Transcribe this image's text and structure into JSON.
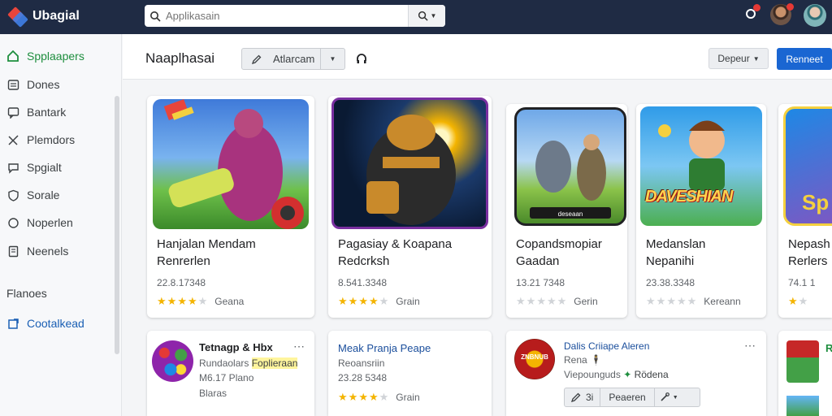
{
  "app": {
    "name": "Ubagial"
  },
  "search": {
    "placeholder": "Applikasain",
    "value": ""
  },
  "header": {
    "title": "Naaplhasai",
    "action_label": "Atlarcam",
    "sort_label": "Depeur",
    "primary_label": "Renneet"
  },
  "sidebar": {
    "items": [
      {
        "label": "Spplaapers",
        "icon": "home-icon"
      },
      {
        "label": "Dones",
        "icon": "list-icon"
      },
      {
        "label": "Bantark",
        "icon": "chat-icon"
      },
      {
        "label": "Plemdors",
        "icon": "tools-icon"
      },
      {
        "label": "Spgialt",
        "icon": "bubble-icon"
      },
      {
        "label": "Sorale",
        "icon": "shield-icon"
      },
      {
        "label": "Noperlen",
        "icon": "circle-icon"
      },
      {
        "label": "Neenels",
        "icon": "doc-icon"
      }
    ],
    "section_label": "Flanoes",
    "link_label": "Cootalkead"
  },
  "featured": [
    {
      "line1": "Hanjalan Mendam",
      "line2": "Renrerlen",
      "meta": "22.8.17348",
      "stars": 4,
      "label": "Geana"
    },
    {
      "line1": "Pagasiay & Koapana",
      "line2": "Redcrksh",
      "meta": "8.541.3348",
      "stars": 4,
      "label": "Grain"
    },
    {
      "line1": "Copandsmopiar",
      "line2": "Gaadan",
      "meta": "13.21 7348",
      "stars": 0,
      "label": "Gerin"
    },
    {
      "line1": "Medanslan",
      "line2": "Nepanihi",
      "meta": "23.38.3348",
      "stars": 0,
      "label": "Kereann"
    },
    {
      "line1": "Nepash",
      "line2": "Rerlers",
      "meta": "74.1 1",
      "stars": 1,
      "label": ""
    }
  ],
  "row2": {
    "card1": {
      "title": "Tetnagp & Hbx",
      "subtitle": "Rundaolars",
      "highlight": "Foplieraan",
      "line2": "M6.17 Plano",
      "line3": "Blaras"
    },
    "card2": {
      "title": "Meak Pranja Peape",
      "subtitle": "Reoansriin",
      "meta": "23.28 5348",
      "stars": 4,
      "label": "Grain"
    },
    "card3": {
      "title": "Dalis Criiape Aleren",
      "line1": "Rena",
      "line2": "Viepounguds",
      "tag": "Rödena",
      "action_count": "3i",
      "action_label": "Peaeren",
      "badge_text": "ZNBNUB"
    },
    "card4": {
      "title": "R"
    }
  },
  "featured_art_text": {
    "card3": "deseaan",
    "card4": "DAVESHIAN",
    "card5": "Sp"
  },
  "colors": {
    "topbar": "#1f2b44",
    "accent": "#1a66d2",
    "active": "#1e8e3e",
    "star": "#f4b400"
  }
}
